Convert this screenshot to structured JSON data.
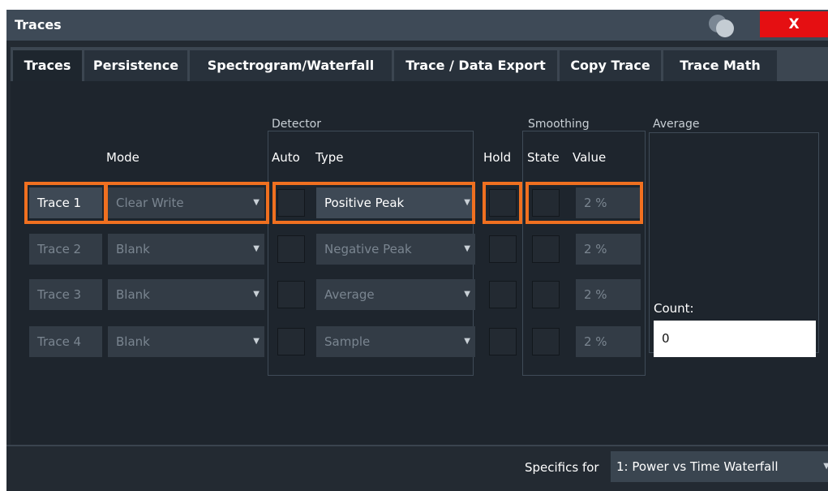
{
  "window": {
    "title": "Traces",
    "close_label": "X"
  },
  "tabs": [
    {
      "label": "Traces",
      "active": true
    },
    {
      "label": "Persistence"
    },
    {
      "label": "Spectrogram/Waterfall"
    },
    {
      "label": "Trace / Data Export"
    },
    {
      "label": "Copy Trace"
    },
    {
      "label": "Trace Math"
    }
  ],
  "headers": {
    "detector": "Detector",
    "smoothing": "Smoothing",
    "average": "Average",
    "mode": "Mode",
    "auto": "Auto",
    "type": "Type",
    "hold": "Hold",
    "state": "State",
    "value": "Value",
    "count": "Count:"
  },
  "traces": [
    {
      "name": "Trace 1",
      "mode": "Clear Write",
      "type": "Positive Peak",
      "value": "2 %",
      "active": true
    },
    {
      "name": "Trace 2",
      "mode": "Blank",
      "type": "Negative Peak",
      "value": "2 %"
    },
    {
      "name": "Trace 3",
      "mode": "Blank",
      "type": "Average",
      "value": "2 %"
    },
    {
      "name": "Trace 4",
      "mode": "Blank",
      "type": "Sample",
      "value": "2 %"
    }
  ],
  "count_value": "0",
  "specifics": {
    "label": "Specifics for",
    "value": "1: Power vs Time Waterfall"
  },
  "colors": {
    "highlight": "#f07020",
    "close": "#e50f12"
  }
}
